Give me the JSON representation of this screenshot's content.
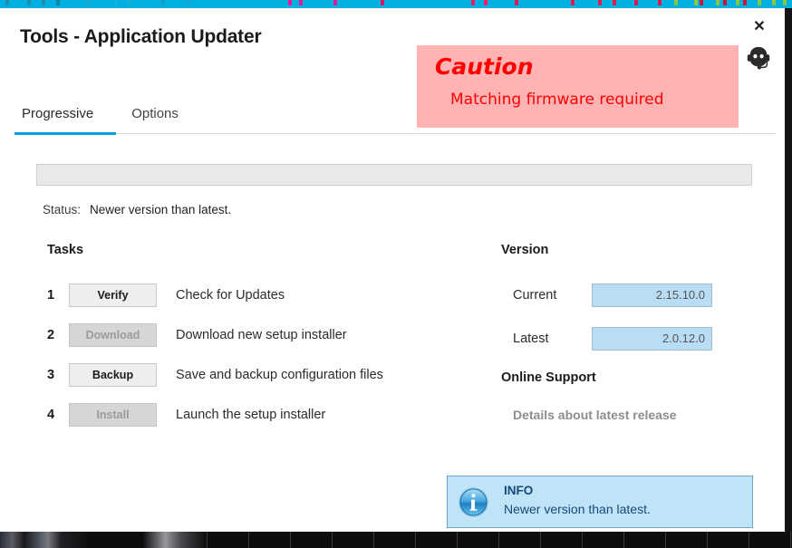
{
  "window": {
    "title": "Tools - Application Updater",
    "close_label": "✕",
    "support_icon": "headset-support-icon"
  },
  "caution": {
    "title": "Caution",
    "message": "Matching firmware required",
    "background": "#ffb3b3",
    "text_color": "#ff0000"
  },
  "tabs": {
    "items": [
      {
        "label": "Progressive",
        "active": true
      },
      {
        "label": "Options",
        "active": false
      }
    ],
    "accent_color": "#00a3dd"
  },
  "progress": {
    "value": 0,
    "fill_color": "#e9e9e9"
  },
  "status": {
    "label": "Status:",
    "value": "Newer version than latest."
  },
  "tasks": {
    "heading": "Tasks",
    "rows": [
      {
        "number": "1",
        "button": "Verify",
        "enabled": true,
        "description": "Check for Updates"
      },
      {
        "number": "2",
        "button": "Download",
        "enabled": false,
        "description": "Download new setup installer"
      },
      {
        "number": "3",
        "button": "Backup",
        "enabled": true,
        "description": "Save and backup configuration files"
      },
      {
        "number": "4",
        "button": "Install",
        "enabled": false,
        "description": "Launch the setup installer"
      }
    ]
  },
  "version": {
    "heading": "Version",
    "rows": [
      {
        "label": "Current",
        "value": "2.15.10.0"
      },
      {
        "label": "Latest",
        "value": "2.0.12.0"
      }
    ],
    "field_color": "#b9ddf4"
  },
  "online_support": {
    "heading": "Online Support",
    "link": "Details about latest release"
  },
  "info": {
    "icon": "info-circle-icon",
    "title": "INFO",
    "message": "Newer version than latest.",
    "background": "#bfe3f7",
    "text_color": "#16487a"
  }
}
